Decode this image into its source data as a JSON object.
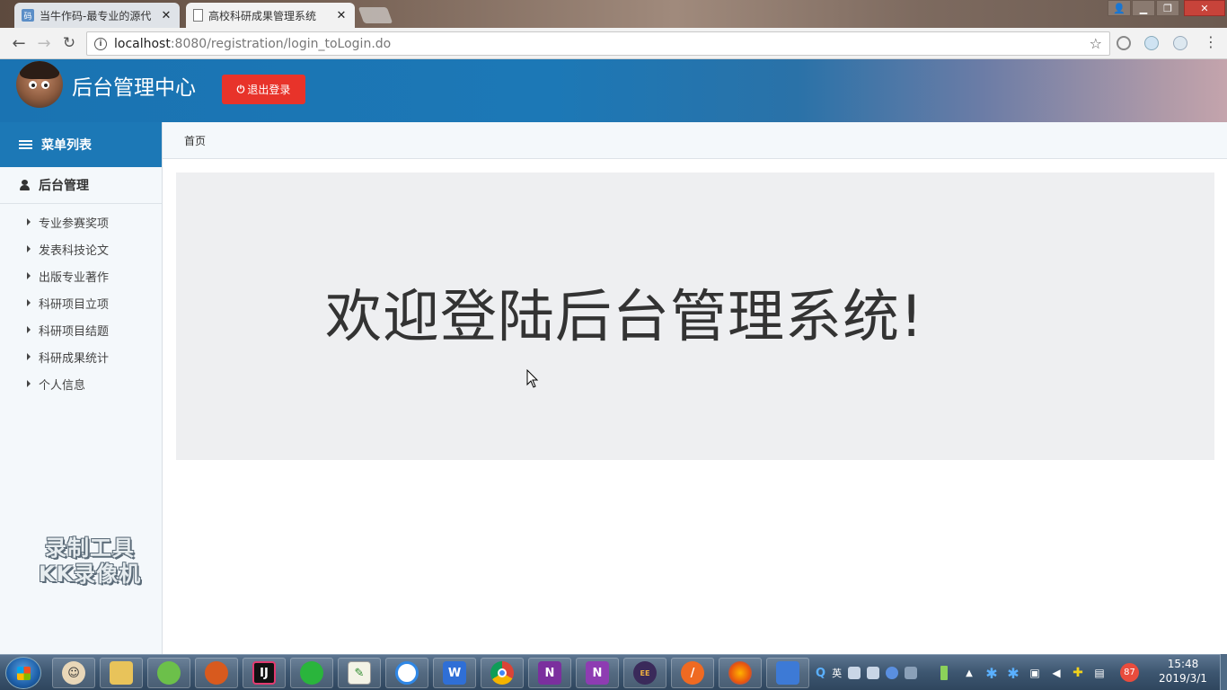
{
  "browser": {
    "tabs": [
      {
        "title": "当牛作码-最专业的源代",
        "active": false,
        "favicon": "site-icon"
      },
      {
        "title": "高校科研成果管理系统",
        "active": true,
        "favicon": "document-icon"
      }
    ],
    "url_host": "localhost",
    "url_rest": ":8080/registration/login_toLogin.do"
  },
  "header": {
    "title": "后台管理中心",
    "logout_label": "退出登录",
    "colors": {
      "primary": "#1c78b6",
      "danger": "#e8332a"
    }
  },
  "sidebar": {
    "menu_title": "菜单列表",
    "group_title": "后台管理",
    "items": [
      {
        "label": "专业参赛奖项"
      },
      {
        "label": "发表科技论文"
      },
      {
        "label": "出版专业著作"
      },
      {
        "label": "科研项目立项"
      },
      {
        "label": "科研项目结题"
      },
      {
        "label": "科研成果统计"
      },
      {
        "label": "个人信息"
      }
    ],
    "watermark_line1": "录制工具",
    "watermark_line2": "KK录像机"
  },
  "breadcrumb": {
    "home": "首页"
  },
  "main": {
    "welcome": "欢迎登陆后台管理系统!"
  },
  "taskbar": {
    "tray_text1": "Q",
    "tray_text2": "英",
    "notification_count": "87",
    "time": "15:48",
    "date": "2019/3/1"
  }
}
